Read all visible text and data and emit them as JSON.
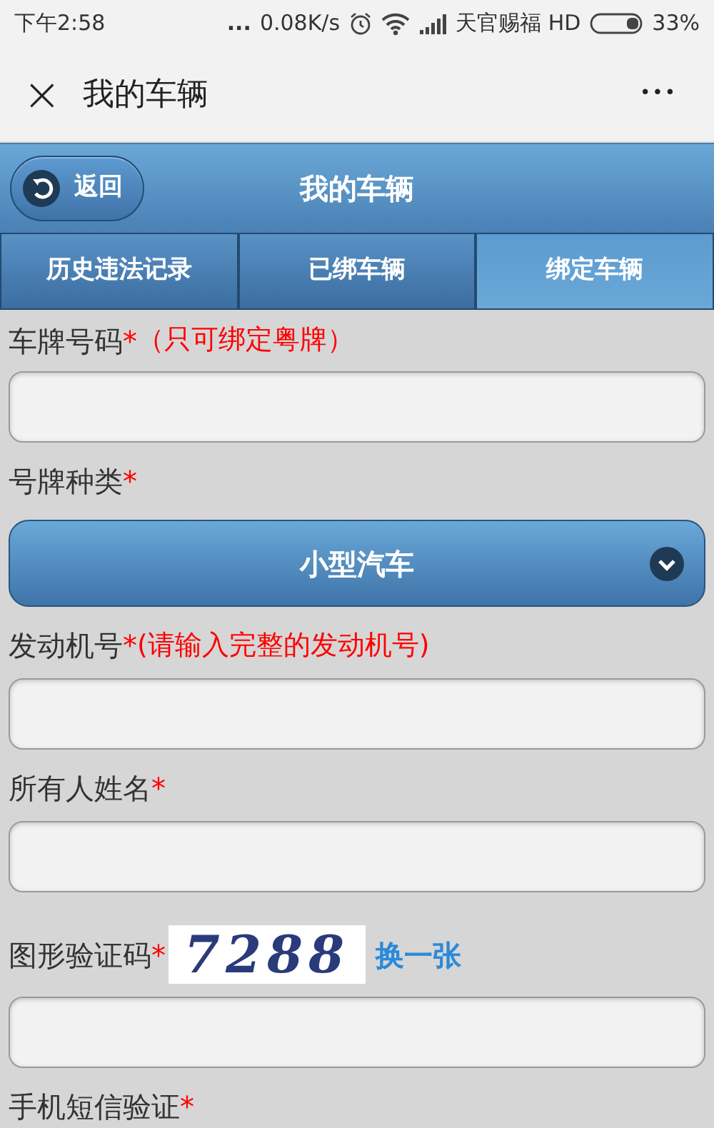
{
  "status_bar": {
    "time": "下午2:58",
    "dots": "...",
    "speed": "0.08K/s",
    "carrier": "天官赐福 HD",
    "battery": "33%"
  },
  "nav_bar": {
    "title": "我的车辆",
    "close": "×",
    "more": "•••"
  },
  "header": {
    "back": "返回",
    "title": "我的车辆"
  },
  "tabs": [
    {
      "label": "历史违法记录",
      "selected": false
    },
    {
      "label": "已绑车辆",
      "selected": false
    },
    {
      "label": "绑定车辆",
      "selected": true
    }
  ],
  "form": [
    {
      "kind": "text",
      "label": "车牌号码",
      "required": "*",
      "note": "（只可绑定粤牌）"
    },
    {
      "kind": "select",
      "label": "号牌种类",
      "required": "*",
      "value": "小型汽车"
    },
    {
      "kind": "text",
      "label": "发动机号",
      "required": "*",
      "note": "(请输入完整的发动机号)"
    },
    {
      "kind": "text",
      "label": "所有人姓名",
      "required": "*"
    },
    {
      "kind": "captcha",
      "label": "图形验证码",
      "required": "*",
      "captcha": "7288",
      "refresh": "换一张"
    },
    {
      "kind": "label",
      "label": "手机短信验证",
      "required": "*"
    }
  ]
}
